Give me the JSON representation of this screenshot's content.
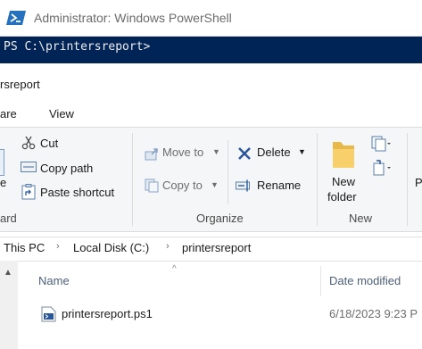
{
  "powershell": {
    "title": "Administrator: Windows PowerShell",
    "prompt": "PS C:\\printersreport>"
  },
  "explorer": {
    "window_title": "rsreport",
    "tabs": [
      "are",
      "View"
    ]
  },
  "ribbon": {
    "clipboard": {
      "label": "ard",
      "partial_button": "e",
      "cut": "Cut",
      "copy_path": "Copy path",
      "paste_shortcut": "Paste shortcut"
    },
    "organize": {
      "label": "Organize",
      "move_to": "Move to",
      "copy_to": "Copy to",
      "delete": "Delete",
      "rename": "Rename"
    },
    "new": {
      "label": "New",
      "new_folder_line1": "New",
      "new_folder_line2": "folder"
    },
    "open_partial": "P"
  },
  "address_bar": {
    "crumbs": [
      "This PC",
      "Local Disk (C:)",
      "printersreport"
    ],
    "separator": "›"
  },
  "file_list": {
    "columns": [
      "Name",
      "Date modified"
    ],
    "files": [
      {
        "name": "printersreport.ps1",
        "date_modified": "6/18/2023 9:23 P"
      }
    ]
  },
  "colors": {
    "console_bg": "#012456",
    "ribbon_bg": "#f5f6f7",
    "folder_yellow": "#f2c94c",
    "delete_blue": "#2b579a"
  }
}
